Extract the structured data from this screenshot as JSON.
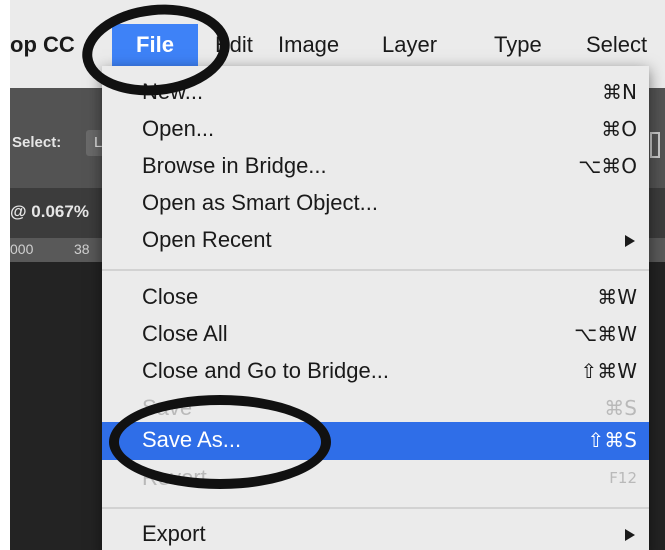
{
  "menubar": {
    "app_name": "op CC",
    "items": [
      "File",
      "Edit",
      "Image",
      "Layer",
      "Type",
      "Select"
    ]
  },
  "background": {
    "select_label": "Select:",
    "select_value": "L",
    "zoom_text": "@ 0.067%",
    "ruler_a": "000",
    "ruler_b": "38"
  },
  "file_menu": {
    "items": [
      {
        "label": "New...",
        "shortcut": "⌘N",
        "enabled": true
      },
      {
        "label": "Open...",
        "shortcut": "⌘O",
        "enabled": true
      },
      {
        "label": "Browse in Bridge...",
        "shortcut": "⌥⌘O",
        "enabled": true
      },
      {
        "label": "Open as Smart Object...",
        "shortcut": "",
        "enabled": true
      },
      {
        "label": "Open Recent",
        "shortcut": "",
        "enabled": true,
        "submenu": true
      },
      {
        "label": "Close",
        "shortcut": "⌘W",
        "enabled": true
      },
      {
        "label": "Close All",
        "shortcut": "⌥⌘W",
        "enabled": true
      },
      {
        "label": "Close and Go to Bridge...",
        "shortcut": "⇧⌘W",
        "enabled": true
      },
      {
        "label": "Save",
        "shortcut": "⌘S",
        "enabled": false
      },
      {
        "label": "Save As...",
        "shortcut": "⇧⌘S",
        "enabled": true,
        "highlighted": true
      },
      {
        "label": "Revert",
        "shortcut": "F12",
        "enabled": false
      },
      {
        "label": "Export",
        "shortcut": "",
        "enabled": true,
        "submenu": true
      }
    ]
  },
  "colors": {
    "menu_bg": "#ebebeb",
    "highlight": "#2f6ee8",
    "file_active": "#3e82f7",
    "annotation": "#111111"
  }
}
